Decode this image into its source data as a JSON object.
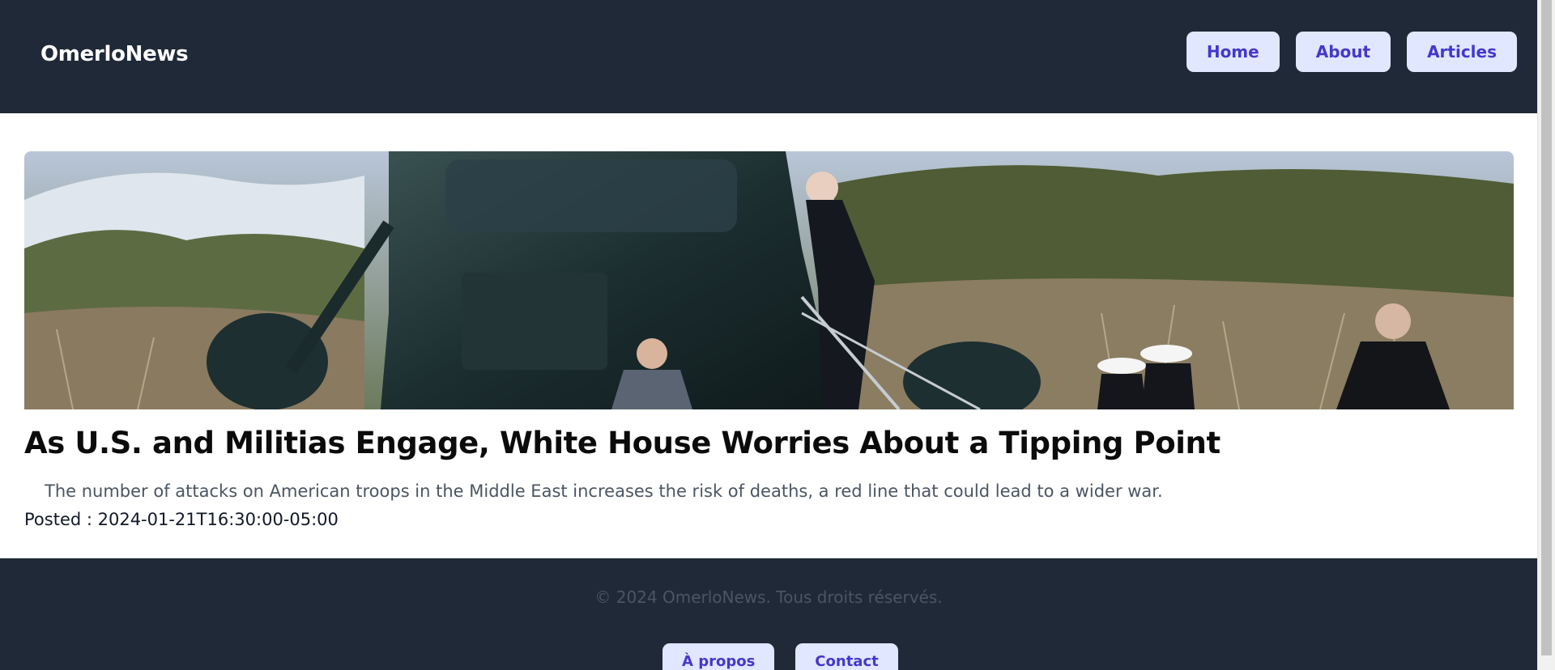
{
  "header": {
    "brand": "OmerloNews",
    "nav": [
      {
        "label": "Home"
      },
      {
        "label": "About"
      },
      {
        "label": "Articles"
      }
    ]
  },
  "article": {
    "image_alt": "Person climbing steps into a dark green helicopter beside saluting Marines",
    "title": "As U.S. and Militias Engage, White House Worries About a Tipping Point",
    "summary": "The number of attacks on American troops in the Middle East increases the risk of deaths, a red line that could lead to a wider war.",
    "posted": "Posted : 2024-01-21T16:30:00-05:00"
  },
  "footer": {
    "copyright": "© 2024 OmerloNews. Tous droits réservés.",
    "links": [
      {
        "label": "À propos"
      },
      {
        "label": "Contact"
      }
    ]
  },
  "colors": {
    "header_bg": "#1f2937",
    "button_bg": "#e0e7ff",
    "button_text": "#4338ca",
    "accent": "#4338ca"
  }
}
